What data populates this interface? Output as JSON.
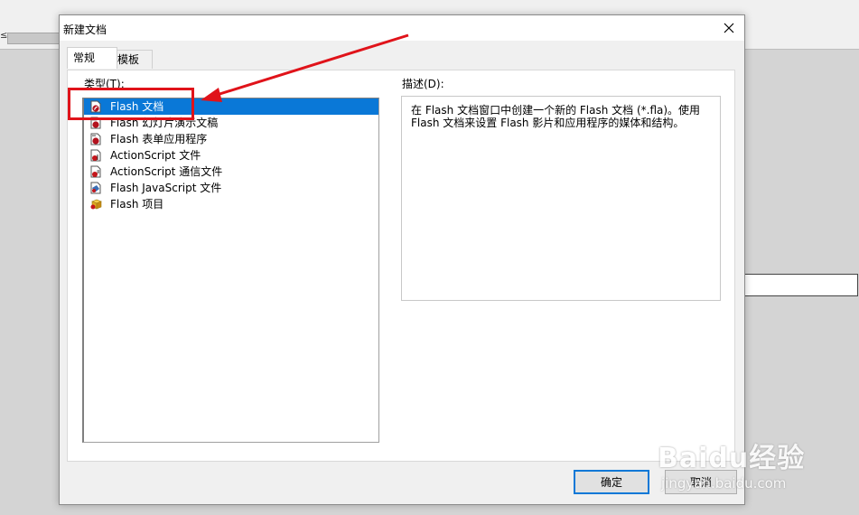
{
  "dialog": {
    "title": "新建文档",
    "tabs": [
      {
        "label": "常规"
      },
      {
        "label": "模板"
      }
    ],
    "type_label": "类型(T):",
    "desc_label": "描述(D):",
    "list_items": [
      {
        "label": "Flash 文档",
        "icon": "flash-document-icon"
      },
      {
        "label": "Flash 幻灯片演示文稿",
        "icon": "flash-slide-icon"
      },
      {
        "label": "Flash 表单应用程序",
        "icon": "flash-form-icon"
      },
      {
        "label": "ActionScript 文件",
        "icon": "actionscript-icon"
      },
      {
        "label": "ActionScript 通信文件",
        "icon": "actionscript-comm-icon"
      },
      {
        "label": "Flash JavaScript 文件",
        "icon": "javascript-icon"
      },
      {
        "label": "Flash 项目",
        "icon": "project-icon"
      }
    ],
    "selected_index": 0,
    "description": "在 Flash 文档窗口中创建一个新的 Flash 文档 (*.fla)。使用 Flash 文档来设置 Flash 影片和应用程序的媒体和结构。",
    "ok_label": "确定",
    "cancel_label": "取消"
  },
  "background": {
    "mark": "≤"
  },
  "watermark": {
    "brand": "Baidu经验",
    "url": "jingyan.baidu.com"
  },
  "colors": {
    "selection": "#0a78d7",
    "annotation": "#e0131a"
  }
}
